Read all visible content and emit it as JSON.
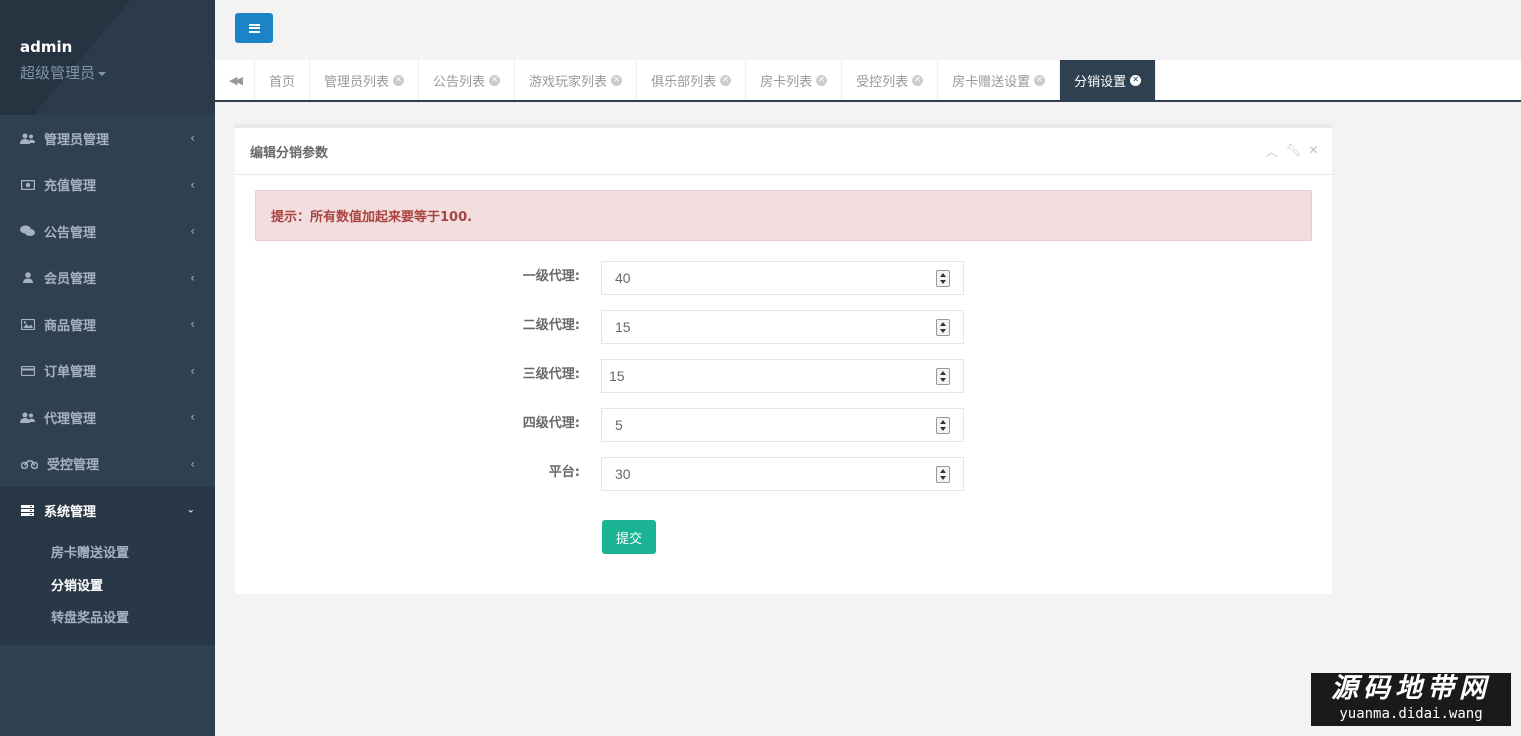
{
  "profile": {
    "username": "admin",
    "role": "超级管理员"
  },
  "sidebar": {
    "items": [
      {
        "label": "管理员管理",
        "icon": "users-icon"
      },
      {
        "label": "充值管理",
        "icon": "money-icon"
      },
      {
        "label": "公告管理",
        "icon": "comments-icon"
      },
      {
        "label": "会员管理",
        "icon": "user-icon"
      },
      {
        "label": "商品管理",
        "icon": "picture-icon"
      },
      {
        "label": "订单管理",
        "icon": "credit-card-icon"
      },
      {
        "label": "代理管理",
        "icon": "users-icon"
      },
      {
        "label": "受控管理",
        "icon": "motorcycle-icon"
      },
      {
        "label": "系统管理",
        "icon": "server-icon"
      }
    ],
    "subitems": [
      {
        "label": "房卡赠送设置"
      },
      {
        "label": "分销设置"
      },
      {
        "label": "转盘奖品设置"
      }
    ]
  },
  "tabs": [
    {
      "label": "首页"
    },
    {
      "label": "管理员列表"
    },
    {
      "label": "公告列表"
    },
    {
      "label": "游戏玩家列表"
    },
    {
      "label": "俱乐部列表"
    },
    {
      "label": "房卡列表"
    },
    {
      "label": "受控列表"
    },
    {
      "label": "房卡赠送设置"
    },
    {
      "label": "分销设置"
    }
  ],
  "panel": {
    "title": "编辑分销参数",
    "alert": "提示：所有数值加起来要等于100.",
    "fields": [
      {
        "label": "一级代理:",
        "value": "40"
      },
      {
        "label": "二级代理:",
        "value": "15"
      },
      {
        "label": "三级代理:",
        "value": "15"
      },
      {
        "label": "四级代理:",
        "value": "5"
      },
      {
        "label": "平台:",
        "value": "30"
      }
    ],
    "submit_label": "提交"
  },
  "watermark": {
    "cn": "源码地带网",
    "en": "yuanma.didai.wang"
  }
}
